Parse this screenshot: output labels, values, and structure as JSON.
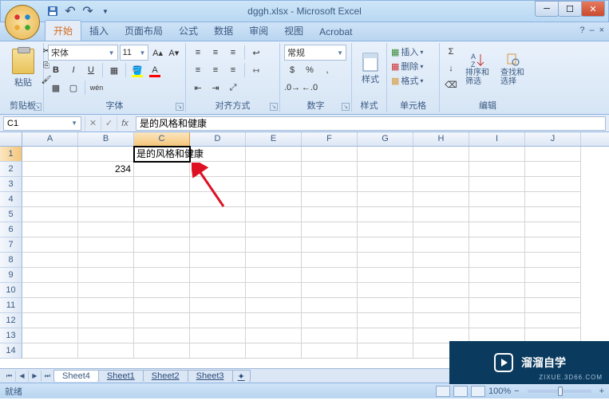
{
  "window": {
    "title": "dggh.xlsx - Microsoft Excel"
  },
  "tabs": {
    "items": [
      "开始",
      "插入",
      "页面布局",
      "公式",
      "数据",
      "审阅",
      "视图",
      "Acrobat"
    ],
    "active_index": 0,
    "help_icon": "?"
  },
  "ribbon": {
    "clipboard": {
      "label": "剪贴板",
      "paste": "粘贴"
    },
    "font": {
      "label": "字体",
      "name": "宋体",
      "size": "11",
      "bold": "B",
      "italic": "I",
      "underline": "U"
    },
    "alignment": {
      "label": "对齐方式"
    },
    "number": {
      "label": "数字",
      "format": "常规"
    },
    "styles": {
      "label": "样式",
      "btn": "样式"
    },
    "cells": {
      "label": "单元格",
      "insert": "插入",
      "delete": "删除",
      "format": "格式"
    },
    "editing": {
      "label": "编辑",
      "sort": "排序和\n筛选",
      "find": "查找和\n选择"
    }
  },
  "formula_bar": {
    "name_box": "C1",
    "fx": "fx",
    "value": "是的风格和健康"
  },
  "grid": {
    "columns": [
      "A",
      "B",
      "C",
      "D",
      "E",
      "F",
      "G",
      "H",
      "I",
      "J"
    ],
    "rows": [
      "1",
      "2",
      "3",
      "4",
      "5",
      "6",
      "7",
      "8",
      "9",
      "10",
      "11",
      "12",
      "13",
      "14"
    ],
    "active_col": "C",
    "active_row": "1",
    "cells": {
      "C1": "是的风格和健康",
      "B2": "234"
    }
  },
  "sheets": {
    "items": [
      "Sheet4",
      "Sheet1",
      "Sheet2",
      "Sheet3"
    ],
    "active_index": 0
  },
  "status": {
    "mode": "就绪",
    "zoom": "100%",
    "minus": "−",
    "plus": "+"
  },
  "watermark": {
    "text": "溜溜自学",
    "sub": "ZIXUE.3D66.COM"
  },
  "chart_data": null
}
